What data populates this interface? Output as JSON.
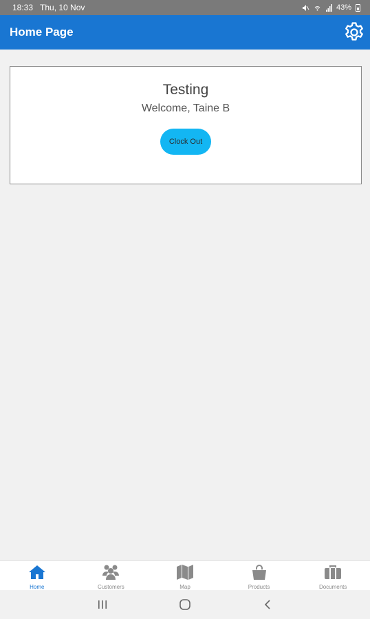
{
  "status_bar": {
    "time": "18:33",
    "date": "Thu, 10 Nov",
    "battery": "43%",
    "icons": [
      "mute-icon",
      "wifi-icon",
      "signal-icon",
      "battery-icon"
    ]
  },
  "app_bar": {
    "title": "Home Page",
    "settings_icon": "gear-icon",
    "color": "#1976d2"
  },
  "card": {
    "title": "Testing",
    "welcome": "Welcome, Taine B",
    "button_label": "Clock Out",
    "button_color": "#13b6f3"
  },
  "bottom_nav": {
    "items": [
      {
        "label": "Home",
        "icon": "home-icon",
        "active": true
      },
      {
        "label": "Customers",
        "icon": "people-icon",
        "active": false
      },
      {
        "label": "Map",
        "icon": "map-icon",
        "active": false
      },
      {
        "label": "Products",
        "icon": "shopping-bag-icon",
        "active": false
      },
      {
        "label": "Documents",
        "icon": "briefcase-icon",
        "active": false
      }
    ],
    "active_color": "#1976d2",
    "inactive_color": "#8a8a8a"
  },
  "system_nav": {
    "buttons": [
      "recent-apps-icon",
      "home-circle-icon",
      "back-icon"
    ]
  }
}
